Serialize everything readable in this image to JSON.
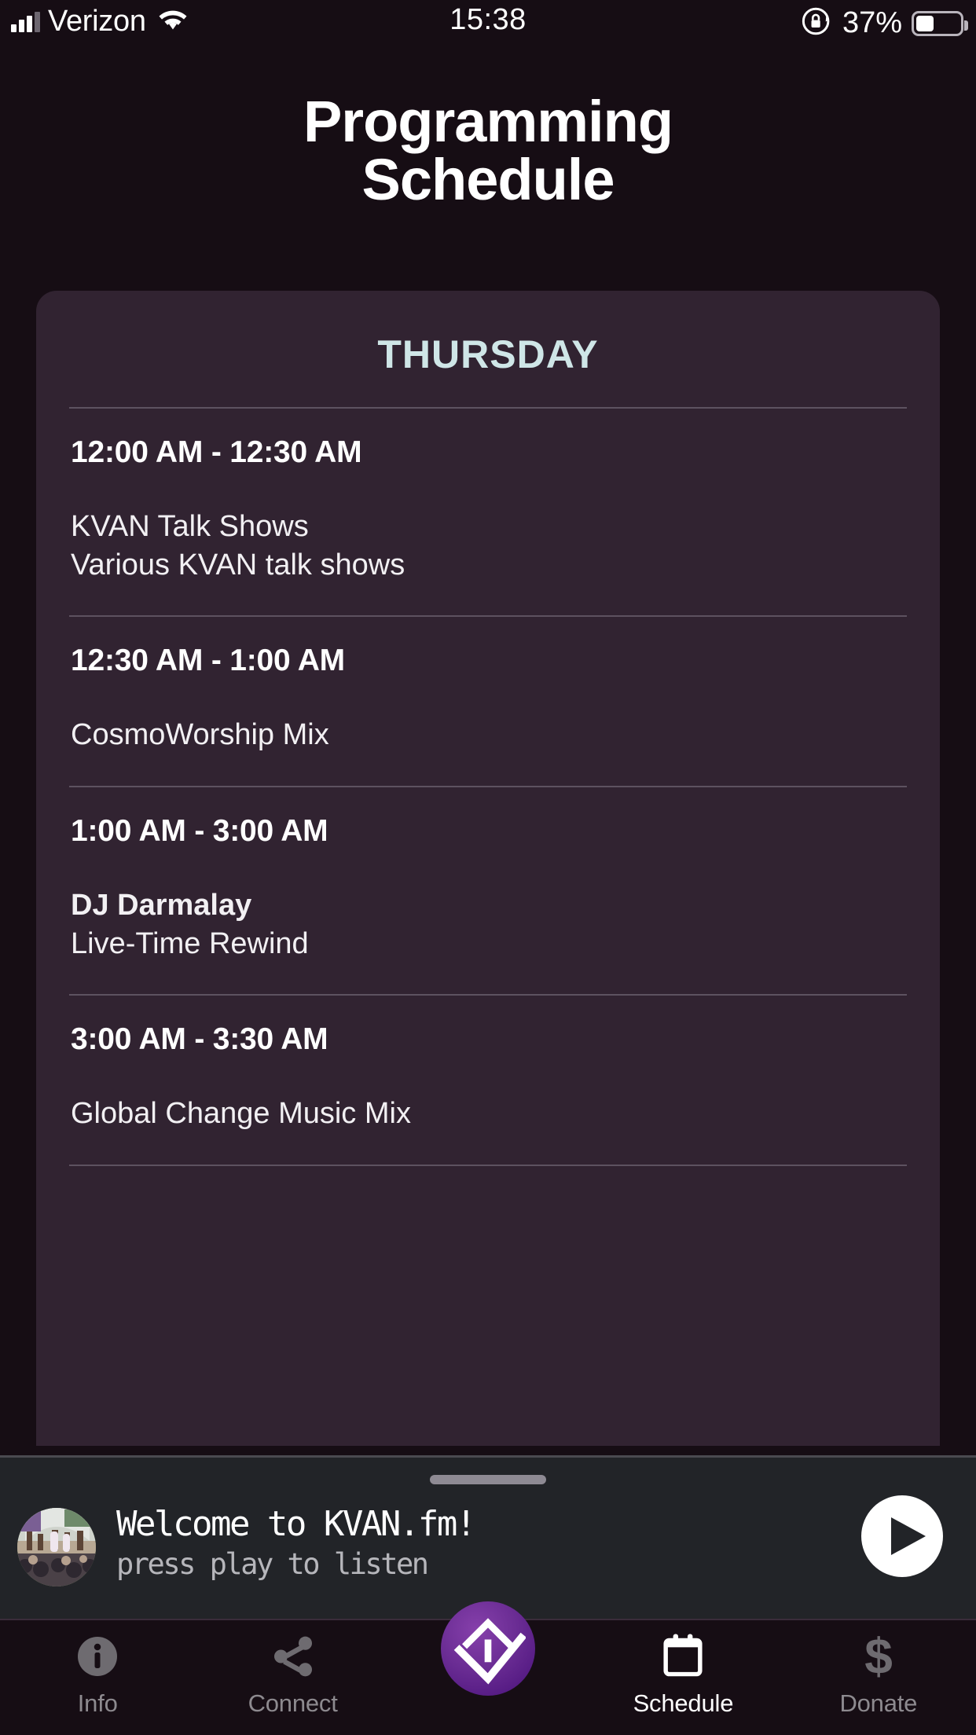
{
  "status_bar": {
    "carrier": "Verizon",
    "time": "15:38",
    "battery_percent": "37%",
    "battery_level": 37,
    "signal_icon": "cellular-signal-icon",
    "wifi_icon": "wifi-icon",
    "rotation_lock_icon": "rotation-lock-icon",
    "battery_icon": "battery-icon"
  },
  "header": {
    "title_line1": "Programming",
    "title_line2": "Schedule"
  },
  "schedule": {
    "day": "THURSDAY",
    "slots": [
      {
        "time": "12:00 AM - 12:30 AM",
        "host": "KVAN Talk Shows",
        "show": "Various KVAN talk shows",
        "host_bold": false
      },
      {
        "time": "12:30 AM - 1:00 AM",
        "host": "",
        "show": "CosmoWorship Mix",
        "host_bold": false
      },
      {
        "time": "1:00 AM - 3:00 AM",
        "host": "DJ Darmalay",
        "show": "Live-Time Rewind",
        "host_bold": true
      },
      {
        "time": "3:00 AM - 3:30 AM",
        "host": "",
        "show": "Global Change Music Mix",
        "host_bold": false
      }
    ]
  },
  "player": {
    "title": "Welcome to KVAN.fm!",
    "subtitle": "press play to listen",
    "play_icon": "play-icon",
    "artwork_icon": "station-artwork",
    "drag_handle_icon": "drag-handle-icon"
  },
  "tabs": [
    {
      "label": "Info",
      "icon": "info-icon",
      "active": false
    },
    {
      "label": "Connect",
      "icon": "share-icon",
      "active": false
    },
    {
      "label": "",
      "icon": "kvan-logo-icon",
      "active": false
    },
    {
      "label": "Schedule",
      "icon": "calendar-icon",
      "active": true
    },
    {
      "label": "Donate",
      "icon": "dollar-icon",
      "active": false
    }
  ],
  "colors": {
    "page_background": "#160d14",
    "card_background": "#312331",
    "day_accent": "#cfe6e7",
    "player_background": "#222428",
    "logo_purple": "#6b2d94",
    "inactive_tab": "#8d8a8f"
  }
}
